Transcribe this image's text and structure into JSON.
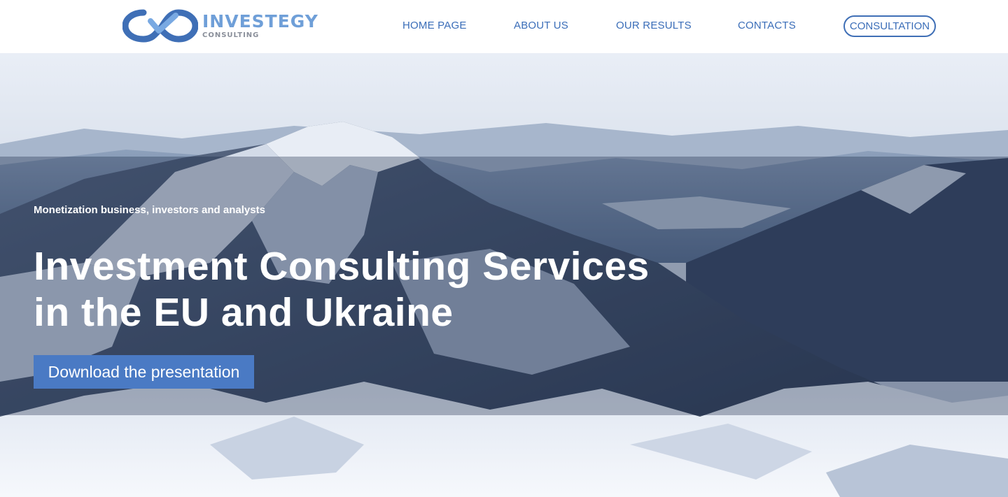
{
  "brand": {
    "name": "INVESTEGY",
    "tagline": "CONSULTING",
    "logo_icon": "infinity-check-logo",
    "colors": {
      "primary": "#3a6db8",
      "light": "#6f9fd8",
      "button": "#4a7ac4"
    }
  },
  "nav": {
    "items": [
      {
        "label": "HOME PAGE"
      },
      {
        "label": "ABOUT US"
      },
      {
        "label": "OUR RESULTS"
      },
      {
        "label": "CONTACTS"
      }
    ],
    "cta_label": "CONSULTATION"
  },
  "hero": {
    "eyebrow": "Monetization business, investors and analysts",
    "title_line1": "Investment Consulting Services",
    "title_line2": "in the EU and Ukraine",
    "button_label": "Download the presentation",
    "background": "snowy-mountain-range-photo"
  }
}
